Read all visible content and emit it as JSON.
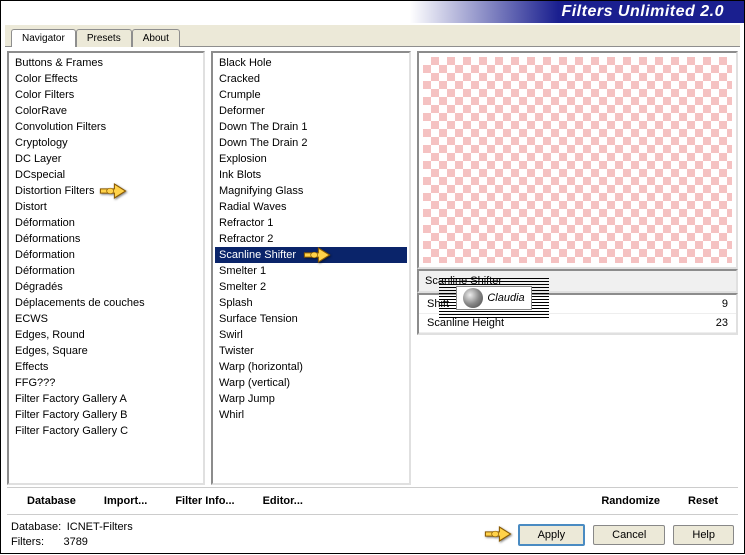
{
  "title": "Filters Unlimited 2.0",
  "tabs": [
    "Navigator",
    "Presets",
    "About"
  ],
  "activeTab": 0,
  "categories": [
    "Buttons & Frames",
    "Color Effects",
    "Color Filters",
    "ColorRave",
    "Convolution Filters",
    "Cryptology",
    "DC Layer",
    "DCspecial",
    "Distortion Filters",
    "Distort",
    "Déformation",
    "Déformations",
    "Déformation",
    "Déformation",
    "Dégradés",
    "Déplacements de couches",
    "ECWS",
    "Edges, Round",
    "Edges, Square",
    "Effects",
    "FFG???",
    "Filter Factory Gallery A",
    "Filter Factory Gallery B",
    "Filter Factory Gallery C"
  ],
  "pointedCategoryIndex": 8,
  "filters": [
    "Black Hole",
    "Cracked",
    "Crumple",
    "Deformer",
    "Down The Drain 1",
    "Down The Drain 2",
    "Explosion",
    "Ink Blots",
    "Magnifying Glass",
    "Radial Waves",
    "Refractor 1",
    "Refractor 2",
    "Scanline Shifter",
    "Smelter 1",
    "Smelter 2",
    "Splash",
    "Surface Tension",
    "Swirl",
    "Twister",
    "Warp (horizontal)",
    "Warp (vertical)",
    "Warp Jump",
    "Whirl"
  ],
  "selectedFilterIndex": 12,
  "selectedFilterName": "Scanline Shifter",
  "params": [
    {
      "name": "Shift",
      "value": 9
    },
    {
      "name": "Scanline Height",
      "value": 23
    }
  ],
  "bottomButtons": {
    "database": "Database",
    "import": "Import...",
    "filterInfo": "Filter Info...",
    "editor": "Editor...",
    "randomize": "Randomize",
    "reset": "Reset"
  },
  "status": {
    "dbLabel": "Database:",
    "dbValue": "ICNET-Filters",
    "filtersLabel": "Filters:",
    "filtersValue": "3789"
  },
  "actionButtons": {
    "apply": "Apply",
    "cancel": "Cancel",
    "help": "Help"
  },
  "watermark": "Claudia"
}
